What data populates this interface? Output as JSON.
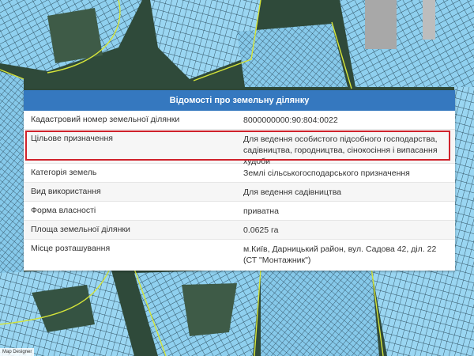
{
  "panel": {
    "title": "Відомості про земельну ділянку",
    "rows": [
      {
        "label": "Кадастровий номер земельної ділянки",
        "value": "8000000000:90:804:0022"
      },
      {
        "label": "Цільове призначення",
        "value": "Для ведення особистого підсобного господарства, садівництва, городництва, сінокосіння і випасання худоби"
      },
      {
        "label": "Категорія земель",
        "value": "Землі сільськогосподарського призначення"
      },
      {
        "label": "Вид використання",
        "value": "Для ведення садівництва"
      },
      {
        "label": "Форма власності",
        "value": "приватна"
      },
      {
        "label": "Площа земельної ділянки",
        "value": "0.0625 га"
      },
      {
        "label": "Місце розташування",
        "value": "м.Київ, Дарницький район, вул. Садова 42, діл. 22 (СТ \"Монтажник\")"
      }
    ]
  },
  "map": {
    "attribution": "Map Designer",
    "parcel_color": "#8fd0ef",
    "terrain_color": "#2f4a3a",
    "outline_color": "#d4e43a",
    "highlight_color": "#d0222b",
    "header_color": "#3578bf"
  }
}
